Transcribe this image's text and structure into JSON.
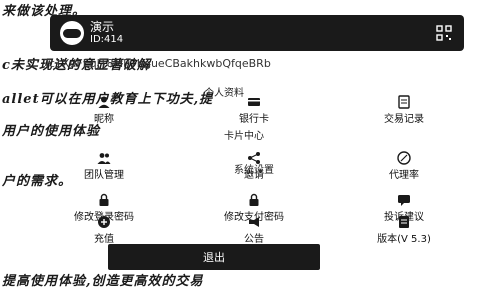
{
  "article": {
    "line1": "来做该处理。",
    "line2": "c未实现送的意显著破解",
    "line3": "allet可以在用户教育上下功夫,提",
    "line4": "用户的使用体验",
    "line5": "户的需求。",
    "line6": "提高使用体验,创造更高效的交易"
  },
  "profile": {
    "name": "演示",
    "id_label": "ID:414",
    "address": "Tc1XdFEqJT8MP7KgueCBakhkwbQfqeBRb"
  },
  "sections": {
    "personal": "个人资料",
    "card_center": "卡片中心",
    "system_settings": "系统设置"
  },
  "menu": {
    "nickname": "昵称",
    "bank_card": "银行卡",
    "transaction_record": "交易记录",
    "team_management": "团队管理",
    "invite": "邀请",
    "agent_rate": "代理率",
    "change_login_password": "修改登录密码",
    "change_trade_password": "修改支付密码",
    "feedback": "投诉建议",
    "recharge": "充值",
    "announcement": "公告",
    "version": "版本(V 5.3)"
  },
  "buttons": {
    "logout": "退出"
  }
}
